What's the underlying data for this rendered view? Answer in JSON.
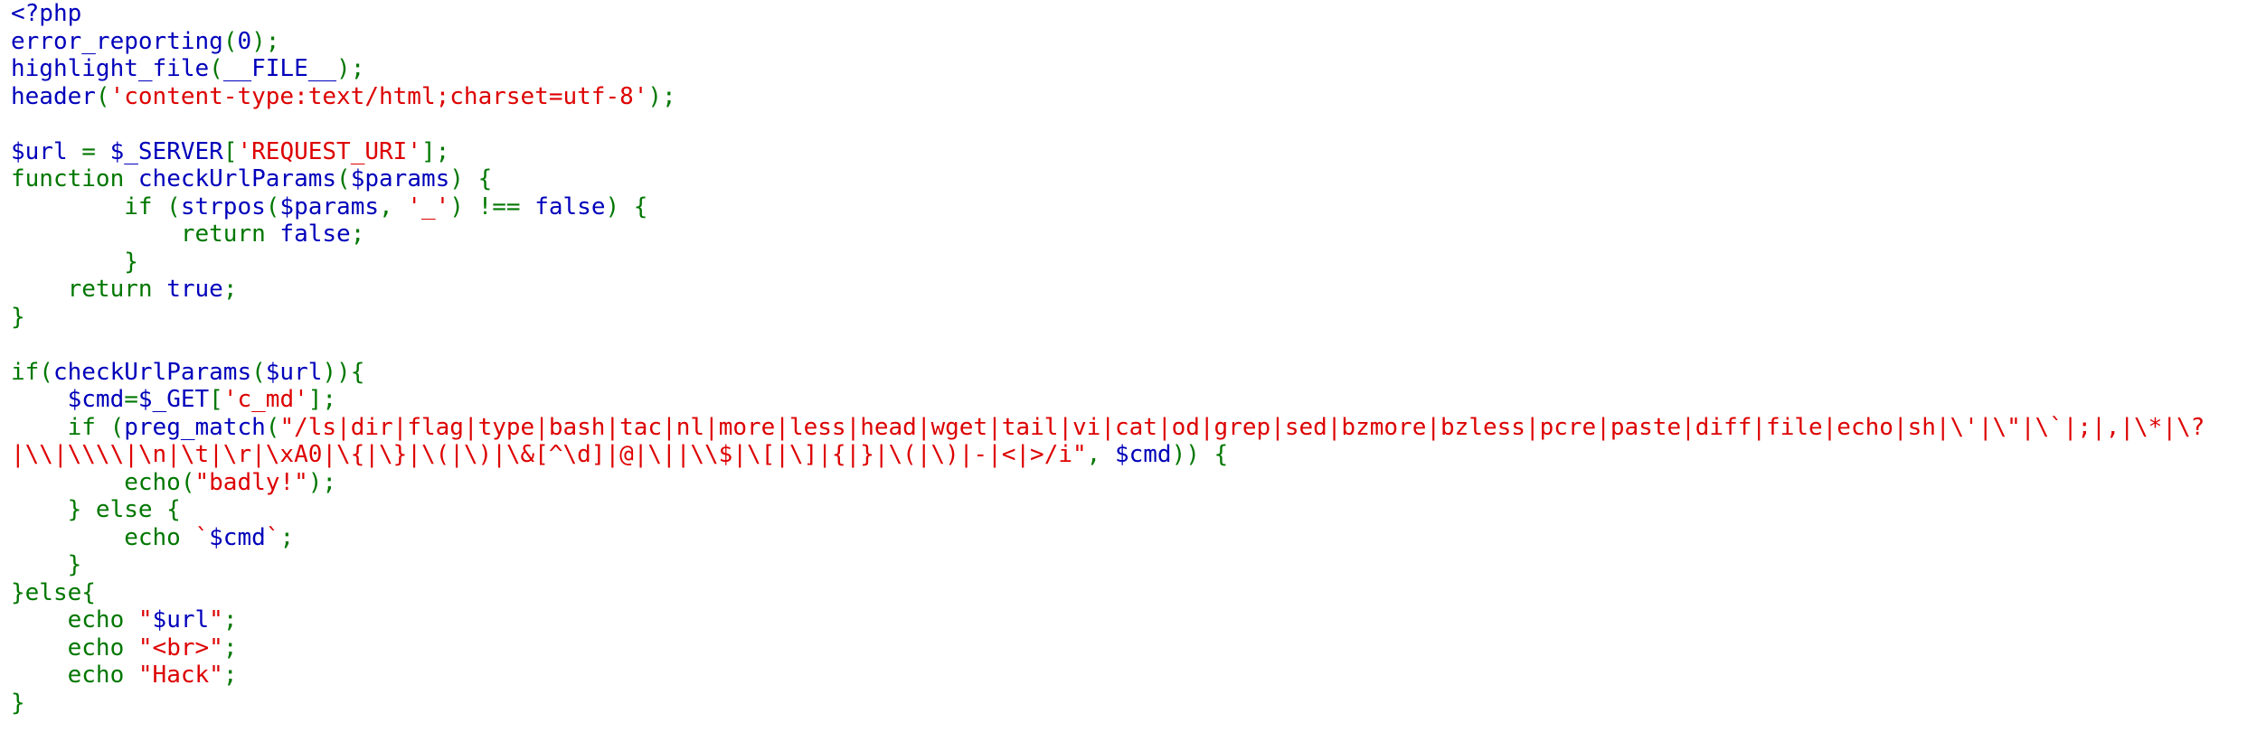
{
  "colors": {
    "default": "#0000bb",
    "keyword": "#007700",
    "string": "#dd0000",
    "background": "#ffffff"
  },
  "code_lines": [
    [
      [
        "default",
        "<?php"
      ]
    ],
    [
      [
        "default",
        "error_reporting"
      ],
      [
        "keyword",
        "("
      ],
      [
        "default",
        "0"
      ],
      [
        "keyword",
        ");"
      ]
    ],
    [
      [
        "default",
        "highlight_file"
      ],
      [
        "keyword",
        "("
      ],
      [
        "default",
        "__FILE__"
      ],
      [
        "keyword",
        ");"
      ]
    ],
    [
      [
        "default",
        "header"
      ],
      [
        "keyword",
        "("
      ],
      [
        "string",
        "'content-type:text/html;charset=utf-8'"
      ],
      [
        "keyword",
        ");"
      ]
    ],
    [],
    [
      [
        "default",
        "$url "
      ],
      [
        "keyword",
        "= "
      ],
      [
        "default",
        "$_SERVER"
      ],
      [
        "keyword",
        "["
      ],
      [
        "string",
        "'REQUEST_URI'"
      ],
      [
        "keyword",
        "];"
      ]
    ],
    [
      [
        "keyword",
        "function "
      ],
      [
        "default",
        "checkUrlParams"
      ],
      [
        "keyword",
        "("
      ],
      [
        "default",
        "$params"
      ],
      [
        "keyword",
        ") {"
      ]
    ],
    [
      [
        "keyword",
        "        if ("
      ],
      [
        "default",
        "strpos"
      ],
      [
        "keyword",
        "("
      ],
      [
        "default",
        "$params"
      ],
      [
        "keyword",
        ", "
      ],
      [
        "string",
        "'_'"
      ],
      [
        "keyword",
        ") !== "
      ],
      [
        "default",
        "false"
      ],
      [
        "keyword",
        ") {"
      ]
    ],
    [
      [
        "keyword",
        "            return "
      ],
      [
        "default",
        "false"
      ],
      [
        "keyword",
        ";"
      ]
    ],
    [
      [
        "keyword",
        "        }"
      ]
    ],
    [
      [
        "keyword",
        "    return "
      ],
      [
        "default",
        "true"
      ],
      [
        "keyword",
        ";"
      ]
    ],
    [
      [
        "keyword",
        "}"
      ]
    ],
    [],
    [
      [
        "keyword",
        "if("
      ],
      [
        "default",
        "checkUrlParams"
      ],
      [
        "keyword",
        "("
      ],
      [
        "default",
        "$url"
      ],
      [
        "keyword",
        ")){"
      ]
    ],
    [
      [
        "default",
        "    $cmd"
      ],
      [
        "keyword",
        "="
      ],
      [
        "default",
        "$_GET"
      ],
      [
        "keyword",
        "["
      ],
      [
        "string",
        "'c_md'"
      ],
      [
        "keyword",
        "];"
      ]
    ],
    [
      [
        "keyword",
        "    if ("
      ],
      [
        "default",
        "preg_match"
      ],
      [
        "keyword",
        "("
      ],
      [
        "string",
        "\"/ls|dir|flag|type|bash|tac|nl|more|less|head|wget|tail|vi|cat|od|grep|sed|bzmore|bzless|pcre|paste|diff|file|echo|sh|\\'|\\\"|\\`|;|,|\\*|\\?"
      ]
    ],
    [
      [
        "string",
        "|\\\\|\\\\\\\\|\\n|\\t|\\r|\\xA0|\\{|\\}|\\(|\\)|\\&[^\\d]|@|\\||\\\\$|\\[|\\]|{|}|\\(|\\)|-|<|>/i\""
      ],
      [
        "keyword",
        ", "
      ],
      [
        "default",
        "$cmd"
      ],
      [
        "keyword",
        ")) {"
      ]
    ],
    [
      [
        "keyword",
        "        echo("
      ],
      [
        "string",
        "\"badly!\""
      ],
      [
        "keyword",
        ");"
      ]
    ],
    [
      [
        "keyword",
        "    } else {"
      ]
    ],
    [
      [
        "keyword",
        "        echo "
      ],
      [
        "string",
        "`"
      ],
      [
        "default",
        "$cmd"
      ],
      [
        "string",
        "`"
      ],
      [
        "keyword",
        ";"
      ]
    ],
    [
      [
        "keyword",
        "    }"
      ]
    ],
    [
      [
        "keyword",
        "}else{"
      ]
    ],
    [
      [
        "keyword",
        "    echo "
      ],
      [
        "string",
        "\""
      ],
      [
        "default",
        "$url"
      ],
      [
        "string",
        "\""
      ],
      [
        "keyword",
        ";"
      ]
    ],
    [
      [
        "keyword",
        "    echo "
      ],
      [
        "string",
        "\"<br>\""
      ],
      [
        "keyword",
        ";"
      ]
    ],
    [
      [
        "keyword",
        "    echo "
      ],
      [
        "string",
        "\"Hack\""
      ],
      [
        "keyword",
        ";"
      ]
    ],
    [
      [
        "keyword",
        "}"
      ]
    ]
  ]
}
